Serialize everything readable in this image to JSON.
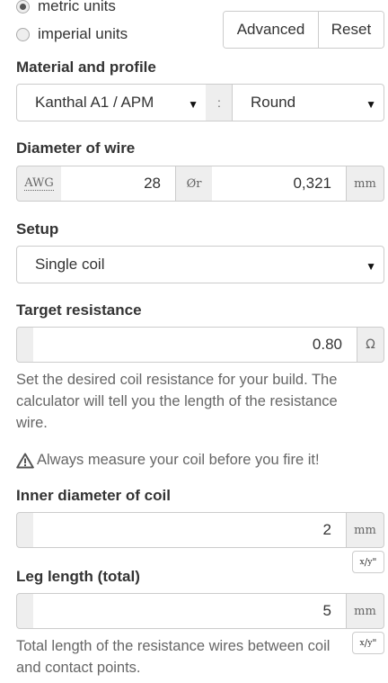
{
  "units": {
    "metric_label": "metric units",
    "imperial_label": "imperial units",
    "selected": "metric"
  },
  "toolbar": {
    "advanced_label": "Advanced",
    "reset_label": "Reset"
  },
  "material": {
    "label": "Material and profile",
    "material_value": "Kanthal A1 / APM",
    "separator": ":",
    "profile_value": "Round"
  },
  "diameter": {
    "label": "Diameter of wire",
    "awg_addon": "AWG",
    "awg_value": "28",
    "diameter_addon": "Ør",
    "diameter_value": "0,321",
    "unit": "mm"
  },
  "setup": {
    "label": "Setup",
    "value": "Single coil"
  },
  "target_resistance": {
    "label": "Target resistance",
    "value": "0.80",
    "unit": "Ω",
    "help": "Set the desired coil resistance for your build. The calculator will tell you the length of the resistance wire."
  },
  "warning": {
    "text": "Always measure your coil before you fire it!"
  },
  "inner_diameter": {
    "label": "Inner diameter of coil",
    "value": "2",
    "unit": "mm",
    "toggle_label": "x/y\""
  },
  "leg_length": {
    "label": "Leg length (total)",
    "value": "5",
    "unit": "mm",
    "toggle_label": "x/y\"",
    "help": "Total length of the resistance wires between coil and contact points."
  },
  "icons": {
    "caret": "chevron-down-icon",
    "warning": "warning-triangle-icon"
  }
}
